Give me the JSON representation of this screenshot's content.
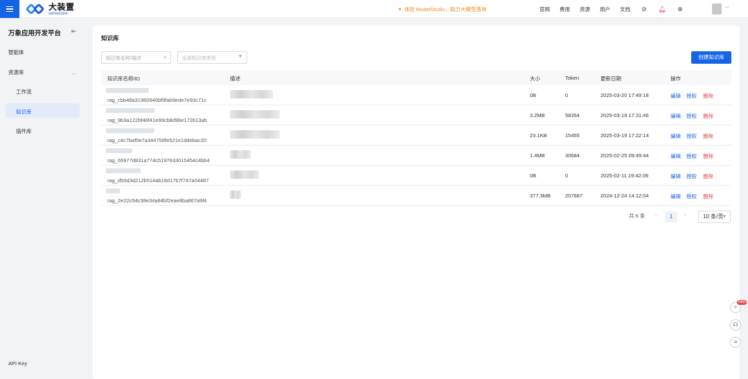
{
  "topbar": {
    "logo_cn": "大装置",
    "logo_en": "sensecore",
    "promo": "体验 ModelStudio，助力大模型落地",
    "nav": [
      "官网",
      "费用",
      "资源",
      "用户",
      "文档"
    ]
  },
  "sidebar": {
    "title": "万象应用开发平台",
    "items": {
      "agent": "智能体",
      "resources": "资源库",
      "workflow": "工作流",
      "knowledge": "知识库",
      "plugins": "插件库",
      "api_key": "API Key"
    }
  },
  "main": {
    "title": "知识库",
    "search_placeholder": "知识库名称/描述",
    "type_placeholder": "全部知识库类型",
    "create_label": "创建知识库",
    "columns": {
      "name": "知识库名称/ID",
      "desc": "描述",
      "size": "大小",
      "token": "Token",
      "date": "更新日期",
      "actions": "操作"
    },
    "action_labels": {
      "edit": "编辑",
      "auth": "授权",
      "delete": "删除"
    },
    "rows": [
      {
        "id": "rag_cbb48a31960946bf9fab9ede7e93c71c",
        "size": "0B",
        "token": "0",
        "date": "2025-03-20 17:49:18"
      },
      {
        "id": "rag_9b3a122bf46f41e99cb8d96e172613ab",
        "size": "3.2MB",
        "token": "58354",
        "date": "2025-03-19 17:31:46"
      },
      {
        "id": "rag_c4c7baf0e7a344758fe521e1ddebac20",
        "size": "23.1KB",
        "token": "15455",
        "date": "2025-03-19 17:22:14"
      },
      {
        "id": "rag_65977d831a774c5197633015454c4bb4",
        "size": "1.4MB",
        "token": "30684",
        "date": "2025-02-25 09:49:44"
      },
      {
        "id": "rag_d50d3d212b514ab18d17b7f747a04487",
        "size": "0B",
        "token": "0",
        "date": "2025-02-11 19:42:09"
      },
      {
        "id": "rag_2e22c54c38e34a84bf2eae8ba867a9f4",
        "size": "377.3MB",
        "token": "207687",
        "date": "2024-12-24 14:12:04"
      }
    ],
    "pager": {
      "total": "共 6 条",
      "current": "1",
      "page_size": "10 条/页"
    }
  },
  "float_tools": {
    "badge": "New"
  },
  "colors": {
    "primary": "#1464e6",
    "danger": "#e5484d",
    "promo": "#f08c1e"
  }
}
